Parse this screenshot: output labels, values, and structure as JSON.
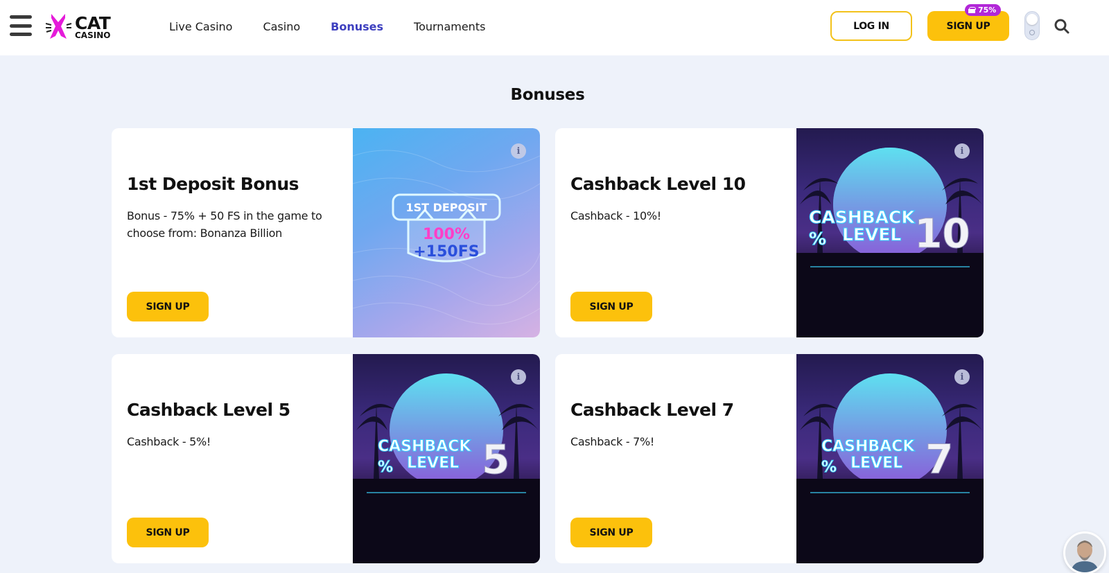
{
  "header": {
    "logo": {
      "title": "CAT",
      "subtitle": "CASINO"
    },
    "nav": [
      {
        "label": "Live Casino",
        "active": false
      },
      {
        "label": "Casino",
        "active": false
      },
      {
        "label": "Bonuses",
        "active": true
      },
      {
        "label": "Tournaments",
        "active": false
      }
    ],
    "login_label": "LOG IN",
    "signup_label": "SIGN UP",
    "signup_badge": "75%"
  },
  "page_title": "Bonuses",
  "cards": [
    {
      "title": "1st Deposit Bonus",
      "description": "Bonus - 75% + 50 FS in the game to choose from: Bonanza Billion",
      "button": "SIGN UP",
      "image": {
        "line1": "1ST DEPOSIT",
        "line2": "100%",
        "line3": "+150FS"
      }
    },
    {
      "title": "Cashback Level 10",
      "description": "Cashback - 10%!",
      "button": "SIGN UP",
      "image": {
        "word1": "CASHBACK",
        "word2": "LEVEL",
        "prefix": "%",
        "number": "10"
      }
    },
    {
      "title": "Cashback Level 5",
      "description": "Cashback - 5%!",
      "button": "SIGN UP",
      "image": {
        "word1": "CASHBACK",
        "word2": "LEVEL",
        "prefix": "%",
        "number": "5"
      }
    },
    {
      "title": "Cashback Level 7",
      "description": "Cashback - 7%!",
      "button": "SIGN UP",
      "image": {
        "word1": "CASHBACK",
        "word2": "LEVEL",
        "prefix": "%",
        "number": "7"
      }
    }
  ],
  "colors": {
    "accent_yellow": "#fcc10c",
    "nav_active": "#3d3fbf",
    "badge_purple": "#b227d8",
    "page_bg": "#eef2fa"
  },
  "icons": [
    "menu-icon",
    "cat-logo-icon",
    "gift-icon",
    "theme-toggle",
    "search-icon",
    "info-icon",
    "support-avatar"
  ]
}
